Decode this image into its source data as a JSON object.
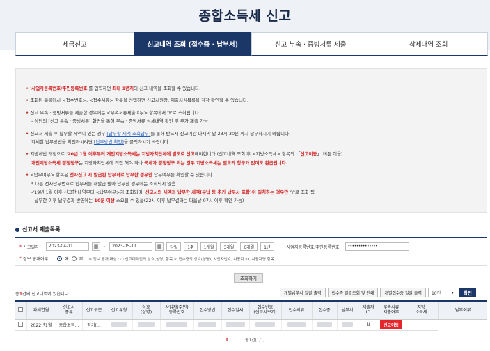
{
  "page_title": "종합소득세 신고",
  "tabs": [
    {
      "label": "세금신고",
      "active": false
    },
    {
      "label": "신고내역 조회 (접수증 · 납부서)",
      "active": true
    },
    {
      "label": "신고 부속 · 증빙서류 제출",
      "active": false
    },
    {
      "label": "삭제내역 조회",
      "active": false
    }
  ],
  "notice": {
    "l1_a": "'사업자등록번호/주민등록번호'",
    "l1_b": "를 입력하면 ",
    "l1_c": "최대 1년치",
    "l1_d": "의 신고 내역을 조회할 수 있습니다.",
    "l2": "조회된 목록에서 <접수번호>, <접수서류> 항목을 선택하면 신고서원장, 제출서식목록을 각각 확인할 수 있습니다.",
    "l3": "신고 부속 · 증빙서류를 제출한 경우에는 <부속서류제출여부> 항목에서 'Y'로 조회됩니다.",
    "l4": "- 상단의 [신고 부속 · 증빙서류] 화면을 통해 부속 · 증빙서류 상세내역 확인 및 추가 제출 가능",
    "l5_a": "신고서 제출 후 납부할 세액이 있는 경우 ",
    "l5_b": "[납부할 세액 조회납부]",
    "l5_c": "를 통해 반드시 신고기간 마지막 날 23시 30분 까지 납부하시기 바랍니다.",
    "l6_a": "자세한 납부방법을 확인하시려면 ",
    "l6_b": "[납부방법 확인]",
    "l6_c": "을 클릭하시기 바랍니다.",
    "l7_a": "지방세법 개정으로 '",
    "l7_b": "20년 1월 이후부터 개인지방소득세는 지방자치단체에 별도로 신고",
    "l7_c": "해야합니다.(신고내역 조회 후 <지방소득세> 항목의 「",
    "l7_d": "신고이동",
    "l7_e": "」 버튼 이용)",
    "l8_a": "개인지방소득세 경정청구",
    "l8_b": "는 지방자치단체에 직접 해야 하나 ",
    "l8_c": "국세가 경정청구 되는 경우 지방소득세는 별도의 청구가 없어도 환급됩니다.",
    "l9_a": "<납부여부> 항목은 ",
    "l9_b": "전자신고 시 발급된 납부서로 납부한 경우만",
    "l9_c": " 납부여부를 확인할 수 있습니다.",
    "l10": "* 다른 전자납부번호로 납부서를 재발급 받아 납부한 경우에는 조회되지 않음",
    "l11_a": "-'19년 1월 이후 신고한 내역부터 <납부여부>가 조회되며, ",
    "l11_b": "신고서의 세액과 납부한 세액(분납 등 추가 납부서 포함)이 일치하는 경우만",
    "l11_c": " 'Y'로 조회 됨",
    "l12_a": "- 납부한 이후 납부결과 반영에는 ",
    "l12_b": "10분 이상",
    "l12_c": " 소요될 수 있음(22시 이후 납부결과는 다음날 07시 이후 확인 가능)"
  },
  "section_title": "신고서 제출목록",
  "filter": {
    "date_label": "신고일자",
    "date_from": "2023-04-11",
    "date_to": "2023-05-11",
    "tilde": "~",
    "period_buttons": [
      "당일",
      "1주",
      "1개월",
      "3개월",
      "6개월",
      "1년"
    ],
    "id_label": "사업자등록번호/주민등록번호",
    "id_value": "••••••••••••••",
    "disclose_label": "정보 공개여부",
    "yes_label": "예",
    "no_label": "부",
    "disclose_note": "※ 정보 공개 대상 : ① 신고대리인의 상호(성명) 항목 ② 접수증의 상호(성명), 사업자번호, 사용자 ID, 사용자명 항목"
  },
  "search_button": "조회하기",
  "results": {
    "count_prefix": "총",
    "count": "1",
    "count_suffix": "건의 신고내역이 있습니다."
  },
  "actions": {
    "bulk_pay": "개별납부서 일괄 출력",
    "bulk_receipt": "접수증 일괄조회 및 인쇄",
    "bulk_receipt2": "개별접수증 일괄 출력",
    "page_size": "10건",
    "ok": "확인"
  },
  "table": {
    "headers": [
      "과세연월",
      "신고서\n종류",
      "신고구분",
      "신고유형",
      "상호\n(성명)",
      "사업자(주민)\n등록번호",
      "접수방법",
      "접수일시",
      "접수번호\n(신고서보기)",
      "접수서류",
      "접수증",
      "납부서",
      "제출자\nID",
      "부속서류\n제출여부",
      "지방\n소득세",
      "납부여부"
    ],
    "rows": [
      {
        "period": "2022년1월",
        "form": "종합소득...",
        "type": "정기(...",
        "submit_yn": "N",
        "local_btn": "신고이동",
        "paid": "-"
      }
    ]
  },
  "pager": {
    "current": "1",
    "info": "총1건(1/1)"
  }
}
